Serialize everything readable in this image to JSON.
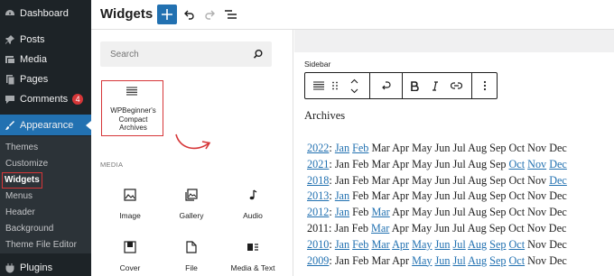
{
  "sidebar": {
    "items": [
      {
        "label": "Dashboard",
        "icon": "dashboard-icon"
      },
      {
        "label": "Posts",
        "icon": "pushpin-icon"
      },
      {
        "label": "Media",
        "icon": "media-icon"
      },
      {
        "label": "Pages",
        "icon": "pages-icon"
      },
      {
        "label": "Comments",
        "icon": "comment-icon",
        "badge": "4"
      },
      {
        "label": "Appearance",
        "icon": "paintbrush-icon"
      },
      {
        "label": "Plugins",
        "icon": "plugin-icon"
      }
    ],
    "submenu": [
      "Themes",
      "Customize",
      "Widgets",
      "Menus",
      "Header",
      "Background",
      "Theme File Editor"
    ],
    "current_submenu": "Widgets"
  },
  "header": {
    "title": "Widgets",
    "add_icon": "plus-icon",
    "undo_icon": "undo-icon",
    "redo_icon": "redo-icon",
    "list_view_icon": "list-view-icon",
    "accent": "#2271b1"
  },
  "inserter": {
    "search_placeholder": "Search",
    "highlight_block": {
      "label_lines": [
        "WPBeginner's",
        "Compact",
        "Archives"
      ],
      "icon": "archive-list-icon"
    },
    "media_heading": "MEDIA",
    "blocks": [
      {
        "label": "Image",
        "icon": "image-icon"
      },
      {
        "label": "Gallery",
        "icon": "gallery-icon"
      },
      {
        "label": "Audio",
        "icon": "audio-icon"
      },
      {
        "label": "Cover",
        "icon": "cover-icon"
      },
      {
        "label": "File",
        "icon": "file-icon"
      },
      {
        "label": "Media & Text",
        "icon": "media-text-icon"
      }
    ]
  },
  "editor": {
    "area_label": "Sidebar",
    "archives_title": "Archives",
    "link_color": "#2271b1",
    "rows": [
      {
        "year": "2022",
        "year_link": true,
        "months": [
          [
            "Jan",
            1
          ],
          [
            "Feb",
            1
          ],
          [
            "Mar",
            0
          ],
          [
            "Apr",
            0
          ],
          [
            "May",
            0
          ],
          [
            "Jun",
            0
          ],
          [
            "Jul",
            0
          ],
          [
            "Aug",
            0
          ],
          [
            "Sep",
            0
          ],
          [
            "Oct",
            0
          ],
          [
            "Nov",
            0
          ],
          [
            "Dec",
            0
          ]
        ]
      },
      {
        "year": "2021",
        "year_link": true,
        "months": [
          [
            "Jan",
            0
          ],
          [
            "Feb",
            0
          ],
          [
            "Mar",
            0
          ],
          [
            "Apr",
            0
          ],
          [
            "May",
            0
          ],
          [
            "Jun",
            0
          ],
          [
            "Jul",
            0
          ],
          [
            "Aug",
            0
          ],
          [
            "Sep",
            0
          ],
          [
            "Oct",
            1
          ],
          [
            "Nov",
            1
          ],
          [
            "Dec",
            1
          ]
        ]
      },
      {
        "year": "2018",
        "year_link": true,
        "months": [
          [
            "Jan",
            0
          ],
          [
            "Feb",
            0
          ],
          [
            "Mar",
            0
          ],
          [
            "Apr",
            0
          ],
          [
            "May",
            0
          ],
          [
            "Jun",
            0
          ],
          [
            "Jul",
            0
          ],
          [
            "Aug",
            0
          ],
          [
            "Sep",
            0
          ],
          [
            "Oct",
            0
          ],
          [
            "Nov",
            0
          ],
          [
            "Dec",
            1
          ]
        ]
      },
      {
        "year": "2013",
        "year_link": true,
        "months": [
          [
            "Jan",
            1
          ],
          [
            "Feb",
            0
          ],
          [
            "Mar",
            0
          ],
          [
            "Apr",
            0
          ],
          [
            "May",
            0
          ],
          [
            "Jun",
            0
          ],
          [
            "Jul",
            0
          ],
          [
            "Aug",
            0
          ],
          [
            "Sep",
            0
          ],
          [
            "Oct",
            0
          ],
          [
            "Nov",
            0
          ],
          [
            "Dec",
            0
          ]
        ]
      },
      {
        "year": "2012",
        "year_link": true,
        "months": [
          [
            "Jan",
            1
          ],
          [
            "Feb",
            0
          ],
          [
            "Mar",
            1
          ],
          [
            "Apr",
            0
          ],
          [
            "May",
            0
          ],
          [
            "Jun",
            0
          ],
          [
            "Jul",
            0
          ],
          [
            "Aug",
            0
          ],
          [
            "Sep",
            0
          ],
          [
            "Oct",
            0
          ],
          [
            "Nov",
            0
          ],
          [
            "Dec",
            0
          ]
        ]
      },
      {
        "year": "2011",
        "year_link": false,
        "months": [
          [
            "Jan",
            0
          ],
          [
            "Feb",
            0
          ],
          [
            "Mar",
            1
          ],
          [
            "Apr",
            0
          ],
          [
            "May",
            0
          ],
          [
            "Jun",
            0
          ],
          [
            "Jul",
            0
          ],
          [
            "Aug",
            0
          ],
          [
            "Sep",
            0
          ],
          [
            "Oct",
            0
          ],
          [
            "Nov",
            0
          ],
          [
            "Dec",
            0
          ]
        ]
      },
      {
        "year": "2010",
        "year_link": true,
        "months": [
          [
            "Jan",
            1
          ],
          [
            "Feb",
            1
          ],
          [
            "Mar",
            1
          ],
          [
            "Apr",
            1
          ],
          [
            "May",
            1
          ],
          [
            "Jun",
            1
          ],
          [
            "Jul",
            1
          ],
          [
            "Aug",
            1
          ],
          [
            "Sep",
            1
          ],
          [
            "Oct",
            1
          ],
          [
            "Nov",
            0
          ],
          [
            "Dec",
            0
          ]
        ]
      },
      {
        "year": "2009",
        "year_link": true,
        "months": [
          [
            "Jan",
            0
          ],
          [
            "Feb",
            0
          ],
          [
            "Mar",
            0
          ],
          [
            "Apr",
            0
          ],
          [
            "May",
            1
          ],
          [
            "Jun",
            1
          ],
          [
            "Jul",
            1
          ],
          [
            "Aug",
            1
          ],
          [
            "Sep",
            1
          ],
          [
            "Oct",
            1
          ],
          [
            "Nov",
            0
          ],
          [
            "Dec",
            0
          ]
        ]
      }
    ]
  }
}
